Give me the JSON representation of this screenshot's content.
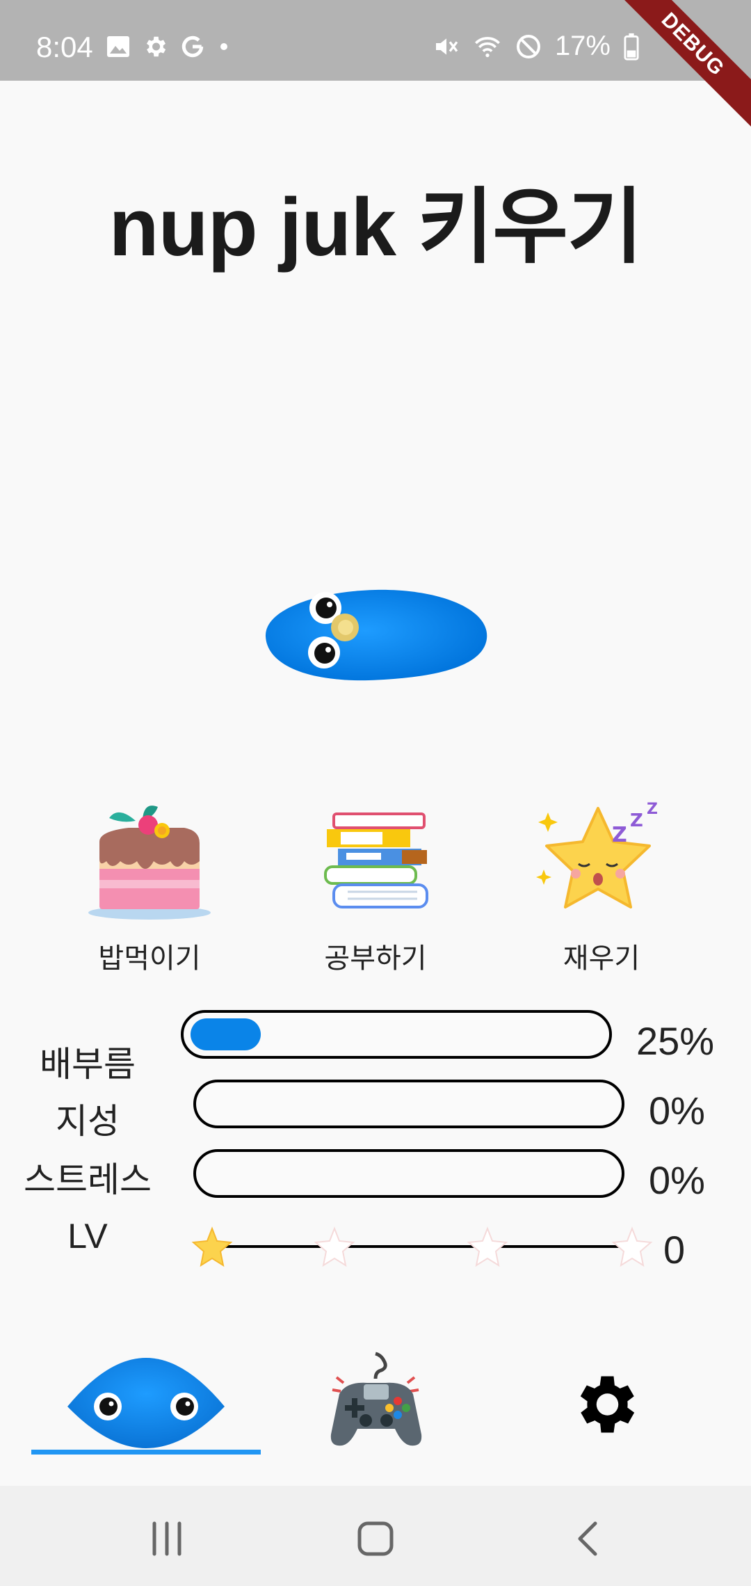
{
  "status_bar": {
    "time": "8:04",
    "battery": "17%",
    "left_icons": [
      "image-icon",
      "gear-icon",
      "google-icon",
      "dot-icon"
    ],
    "right_icons": [
      "mute-icon",
      "wifi-icon",
      "do-not-disturb-icon",
      "battery-charging-icon"
    ]
  },
  "debug_banner": "DEBUG",
  "title": "nup juk 키우기",
  "actions": [
    {
      "label": "밥먹이기",
      "icon": "cake-icon"
    },
    {
      "label": "공부하기",
      "icon": "books-icon"
    },
    {
      "label": "재우기",
      "icon": "sleeping-star-icon"
    }
  ],
  "stats": [
    {
      "label": "배부름",
      "value_text": "25%",
      "value": 0.25
    },
    {
      "label": "지성",
      "value_text": "0%",
      "value": 0
    },
    {
      "label": "스트레스",
      "value_text": "0%",
      "value": 0
    }
  ],
  "level": {
    "label": "LV",
    "value_text": "0",
    "stars_total": 4,
    "stars_filled": 1
  },
  "bottom_nav": [
    {
      "name": "pet",
      "icon": "nupjuk-icon",
      "active": true
    },
    {
      "name": "game",
      "icon": "gamepad-icon",
      "active": false
    },
    {
      "name": "settings",
      "icon": "gear-icon",
      "active": false
    }
  ],
  "colors": {
    "accent": "#0a84e8",
    "indicator": "#2196f3",
    "status_bar": "#b3b3b3",
    "debug": "#8b1a1a"
  }
}
